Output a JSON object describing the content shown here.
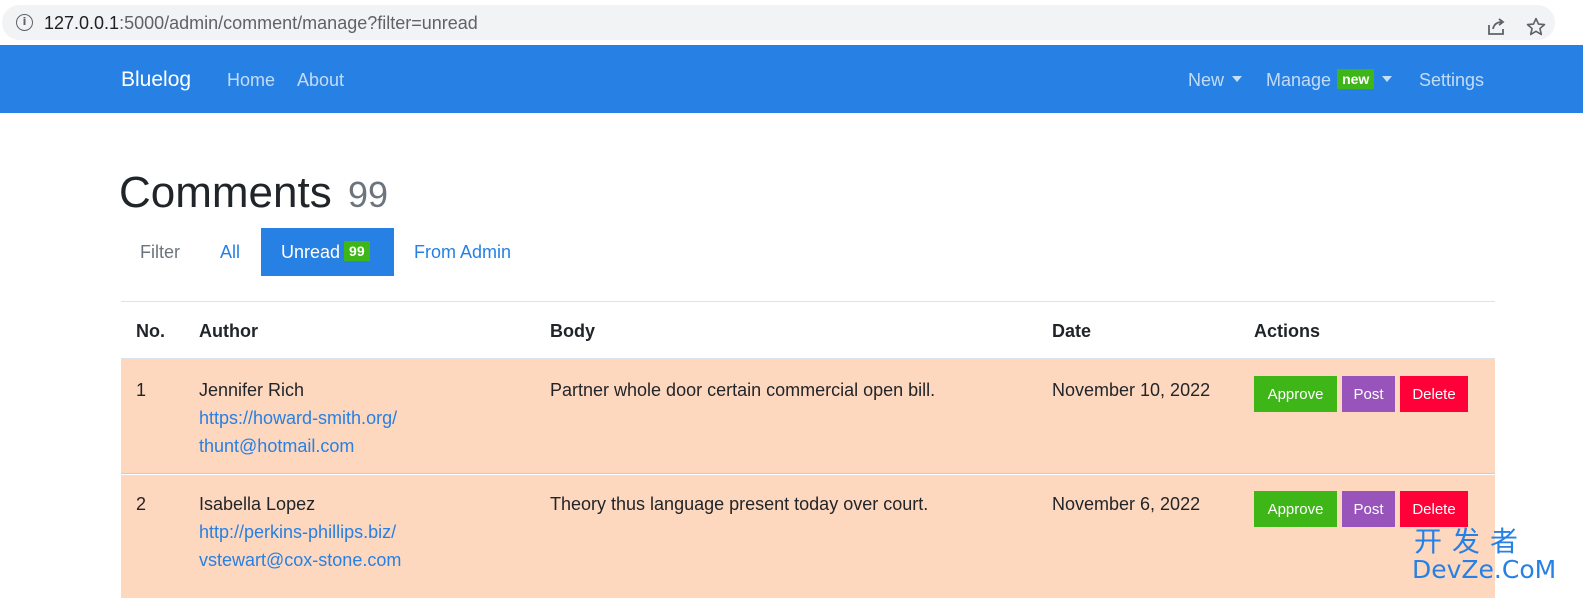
{
  "browser": {
    "url_host": "127.0.0.1",
    "url_rest": ":5000/admin/comment/manage?filter=unread"
  },
  "navbar": {
    "brand": "Bluelog",
    "left_links": [
      "Home",
      "About"
    ],
    "new_label": "New",
    "manage_label": "Manage",
    "manage_badge": "new",
    "settings_label": "Settings"
  },
  "page": {
    "title": "Comments",
    "count": "99"
  },
  "filter": {
    "label": "Filter",
    "all": "All",
    "unread": "Unread",
    "unread_count": "99",
    "from_admin": "From Admin"
  },
  "table": {
    "headers": [
      "No.",
      "Author",
      "Body",
      "Date",
      "Actions"
    ],
    "rows": [
      {
        "no": "1",
        "author": "Jennifer Rich",
        "site": "https://howard-smith.org/",
        "email": "thunt@hotmail.com",
        "body": "Partner whole door certain commercial open bill.",
        "date": "November 10, 2022"
      },
      {
        "no": "2",
        "author": "Isabella Lopez",
        "site": "http://perkins-phillips.biz/",
        "email": "vstewart@cox-stone.com",
        "body": "Theory thus language present today over court.",
        "date": "November 6, 2022"
      }
    ],
    "actions": {
      "approve": "Approve",
      "post": "Post",
      "delete": "Delete"
    }
  },
  "watermark": {
    "top": "开发者",
    "bottom": "DevZe.CoM"
  },
  "colors": {
    "primary": "#2780e3",
    "success": "#3fb618",
    "purple": "#9954bb",
    "danger": "#ff0039",
    "row_highlight": "#fed7bf"
  }
}
